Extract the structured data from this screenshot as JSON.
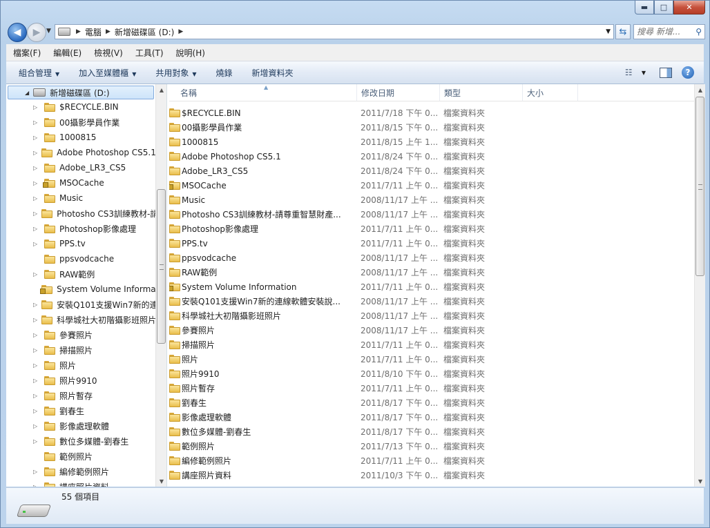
{
  "window": {
    "minimize_glyph": "▬",
    "maximize_glyph": "□",
    "close_glyph": "✕"
  },
  "address": {
    "crumbs": [
      "電腦",
      "新增磁碟區 (D:)"
    ],
    "search_placeholder": "搜尋 新增..."
  },
  "menu": [
    "檔案(F)",
    "編輯(E)",
    "檢視(V)",
    "工具(T)",
    "說明(H)"
  ],
  "commands": [
    {
      "label": "組合管理",
      "dropdown": true
    },
    {
      "label": "加入至媒體櫃",
      "dropdown": true
    },
    {
      "label": "共用對象",
      "dropdown": true
    },
    {
      "label": "燒錄",
      "dropdown": false
    },
    {
      "label": "新增資料夾",
      "dropdown": false
    }
  ],
  "tree": {
    "root": "新增磁碟區 (D:)",
    "items": [
      {
        "label": "$RECYCLE.BIN",
        "expand": true,
        "locked": false
      },
      {
        "label": "00攝影學員作業",
        "expand": true,
        "locked": false
      },
      {
        "label": "1000815",
        "expand": true,
        "locked": false
      },
      {
        "label": "Adobe Photoshop CS5.1",
        "expand": true,
        "locked": false
      },
      {
        "label": "Adobe_LR3_CS5",
        "expand": true,
        "locked": false
      },
      {
        "label": "MSOCache",
        "expand": true,
        "locked": true
      },
      {
        "label": "Music",
        "expand": true,
        "locked": false
      },
      {
        "label": "Photosho CS3訓練教材-請",
        "expand": true,
        "locked": false
      },
      {
        "label": "Photoshop影像處理",
        "expand": true,
        "locked": false
      },
      {
        "label": "PPS.tv",
        "expand": true,
        "locked": false
      },
      {
        "label": "ppsvodcache",
        "expand": false,
        "locked": false
      },
      {
        "label": "RAW範例",
        "expand": true,
        "locked": false
      },
      {
        "label": "System Volume Informatio",
        "expand": false,
        "locked": true
      },
      {
        "label": "安裝Q101支援Win7新的連",
        "expand": true,
        "locked": false
      },
      {
        "label": "科學城社大初階攝影班照片",
        "expand": true,
        "locked": false
      },
      {
        "label": "參賽照片",
        "expand": true,
        "locked": false
      },
      {
        "label": "掃描照片",
        "expand": true,
        "locked": false
      },
      {
        "label": "照片",
        "expand": true,
        "locked": false
      },
      {
        "label": "照片9910",
        "expand": true,
        "locked": false
      },
      {
        "label": "照片暫存",
        "expand": true,
        "locked": false
      },
      {
        "label": "劉春生",
        "expand": true,
        "locked": false
      },
      {
        "label": "影像處理軟體",
        "expand": true,
        "locked": false
      },
      {
        "label": "數位多媒體-劉春生",
        "expand": true,
        "locked": false
      },
      {
        "label": "範例照片",
        "expand": false,
        "locked": false
      },
      {
        "label": "編修範例照片",
        "expand": true,
        "locked": false
      },
      {
        "label": "講座照片資料",
        "expand": true,
        "locked": false
      }
    ]
  },
  "columns": {
    "name": "名稱",
    "date": "修改日期",
    "type": "類型",
    "size": "大小"
  },
  "files": [
    {
      "name": "$RECYCLE.BIN",
      "date": "2011/7/18 下午 0...",
      "type": "檔案資料夾",
      "locked": false
    },
    {
      "name": "00攝影學員作業",
      "date": "2011/8/15 下午 0...",
      "type": "檔案資料夾",
      "locked": false
    },
    {
      "name": "1000815",
      "date": "2011/8/15 上午 1...",
      "type": "檔案資料夾",
      "locked": false
    },
    {
      "name": "Adobe Photoshop CS5.1",
      "date": "2011/8/24 下午 0...",
      "type": "檔案資料夾",
      "locked": false
    },
    {
      "name": "Adobe_LR3_CS5",
      "date": "2011/8/24 下午 0...",
      "type": "檔案資料夾",
      "locked": false
    },
    {
      "name": "MSOCache",
      "date": "2011/7/11 上午 0...",
      "type": "檔案資料夾",
      "locked": true
    },
    {
      "name": "Music",
      "date": "2008/11/17 上午 ...",
      "type": "檔案資料夾",
      "locked": false
    },
    {
      "name": "Photosho CS3訓練教材-請尊重智慧財產...",
      "date": "2008/11/17 上午 ...",
      "type": "檔案資料夾",
      "locked": false
    },
    {
      "name": "Photoshop影像處理",
      "date": "2011/7/11 上午 0...",
      "type": "檔案資料夾",
      "locked": false
    },
    {
      "name": "PPS.tv",
      "date": "2011/7/11 上午 0...",
      "type": "檔案資料夾",
      "locked": false
    },
    {
      "name": "ppsvodcache",
      "date": "2008/11/17 上午 ...",
      "type": "檔案資料夾",
      "locked": false
    },
    {
      "name": "RAW範例",
      "date": "2008/11/17 上午 ...",
      "type": "檔案資料夾",
      "locked": false
    },
    {
      "name": "System Volume Information",
      "date": "2011/7/11 上午 0...",
      "type": "檔案資料夾",
      "locked": true
    },
    {
      "name": "安裝Q101支援Win7新的連線軟體安裝說...",
      "date": "2008/11/17 上午 ...",
      "type": "檔案資料夾",
      "locked": false
    },
    {
      "name": "科學城社大初階攝影班照片",
      "date": "2008/11/17 上午 ...",
      "type": "檔案資料夾",
      "locked": false
    },
    {
      "name": "參賽照片",
      "date": "2008/11/17 上午 ...",
      "type": "檔案資料夾",
      "locked": false
    },
    {
      "name": "掃描照片",
      "date": "2011/7/11 上午 0...",
      "type": "檔案資料夾",
      "locked": false
    },
    {
      "name": "照片",
      "date": "2011/7/11 上午 0...",
      "type": "檔案資料夾",
      "locked": false
    },
    {
      "name": "照片9910",
      "date": "2011/8/10 下午 0...",
      "type": "檔案資料夾",
      "locked": false
    },
    {
      "name": "照片暫存",
      "date": "2011/7/11 上午 0...",
      "type": "檔案資料夾",
      "locked": false
    },
    {
      "name": "劉春生",
      "date": "2011/8/17 下午 0...",
      "type": "檔案資料夾",
      "locked": false
    },
    {
      "name": "影像處理軟體",
      "date": "2011/8/17 下午 0...",
      "type": "檔案資料夾",
      "locked": false
    },
    {
      "name": "數位多媒體-劉春生",
      "date": "2011/8/17 下午 0...",
      "type": "檔案資料夾",
      "locked": false
    },
    {
      "name": "範例照片",
      "date": "2011/7/13 下午 0...",
      "type": "檔案資料夾",
      "locked": false
    },
    {
      "name": "編修範例照片",
      "date": "2011/7/11 上午 0...",
      "type": "檔案資料夾",
      "locked": false
    },
    {
      "name": "講座照片資料",
      "date": "2011/10/3 下午 0...",
      "type": "檔案資料夾",
      "locked": false
    }
  ],
  "status": {
    "item_count": "55 個項目"
  }
}
